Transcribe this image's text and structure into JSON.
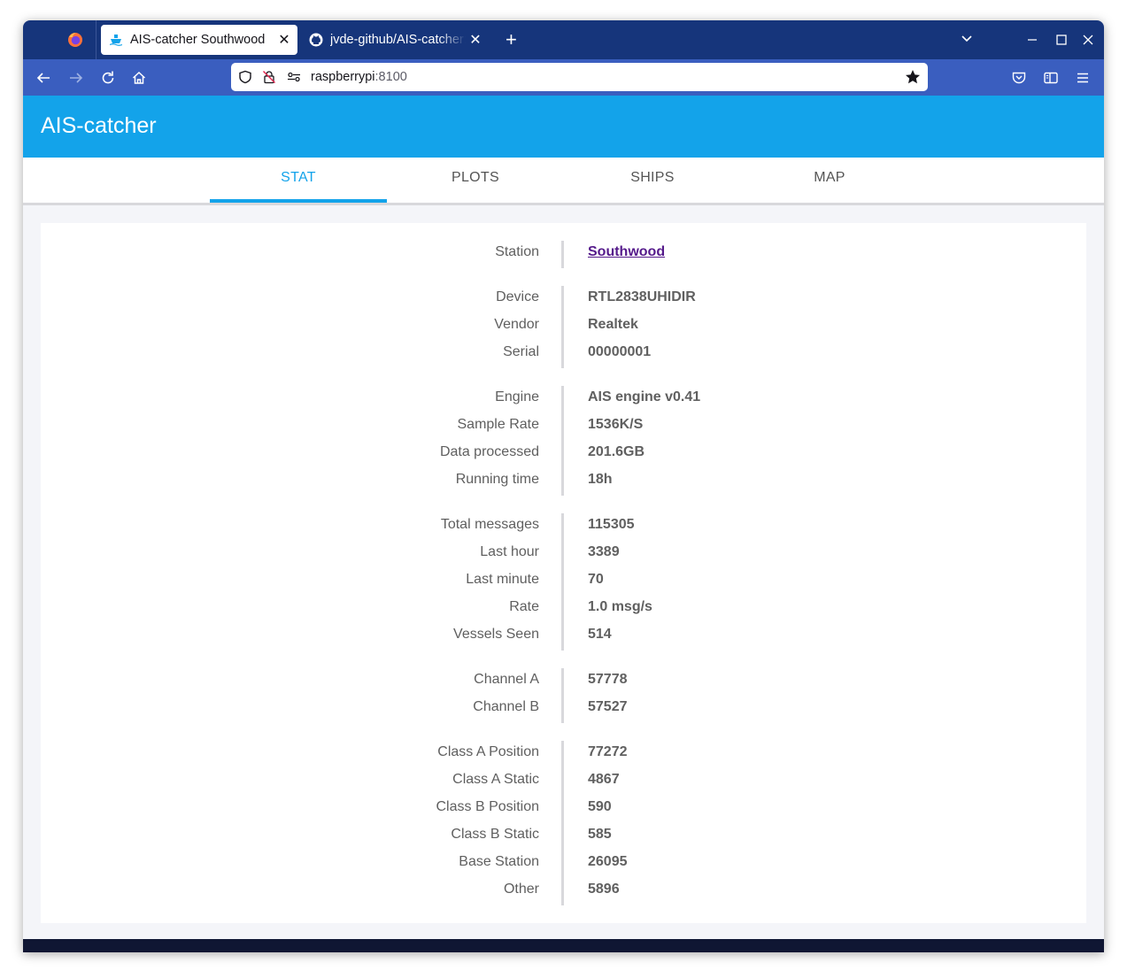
{
  "browser": {
    "tabs": [
      {
        "title": "AIS-catcher Southwood",
        "active": true,
        "favicon": "ship-icon"
      },
      {
        "title": "jvde-github/AIS-catcher: A",
        "active": false,
        "favicon": "github-icon"
      }
    ],
    "url_host": "raspberrypi",
    "url_port": ":8100"
  },
  "app": {
    "title": "AIS-catcher",
    "tabs": [
      "STAT",
      "PLOTS",
      "SHIPS",
      "MAP"
    ],
    "active_tab": "STAT"
  },
  "stats": {
    "station": {
      "label": "Station",
      "value": "Southwood"
    },
    "device": [
      {
        "label": "Device",
        "value": "RTL2838UHIDIR"
      },
      {
        "label": "Vendor",
        "value": "Realtek"
      },
      {
        "label": "Serial",
        "value": "00000001"
      }
    ],
    "engine": [
      {
        "label": "Engine",
        "value": "AIS engine v0.41"
      },
      {
        "label": "Sample Rate",
        "value": "1536K/S"
      },
      {
        "label": "Data processed",
        "value": "201.6GB"
      },
      {
        "label": "Running time",
        "value": "18h"
      }
    ],
    "messages": [
      {
        "label": "Total messages",
        "value": "115305"
      },
      {
        "label": "Last hour",
        "value": "3389"
      },
      {
        "label": "Last minute",
        "value": "70"
      },
      {
        "label": "Rate",
        "value": "1.0 msg/s"
      },
      {
        "label": "Vessels Seen",
        "value": "514"
      }
    ],
    "channels": [
      {
        "label": "Channel A",
        "value": "57778"
      },
      {
        "label": "Channel B",
        "value": "57527"
      }
    ],
    "classes": [
      {
        "label": "Class A Position",
        "value": "77272"
      },
      {
        "label": "Class A Static",
        "value": "4867"
      },
      {
        "label": "Class B Position",
        "value": "590"
      },
      {
        "label": "Class B Static",
        "value": "585"
      },
      {
        "label": "Base Station",
        "value": "26095"
      },
      {
        "label": "Other",
        "value": "5896"
      }
    ]
  },
  "colors": {
    "header": "#13a3ea",
    "tabstrip": "#16357b",
    "navbar": "#3a5ebf",
    "accent": "#13a3ea",
    "link": "#551a8b"
  }
}
